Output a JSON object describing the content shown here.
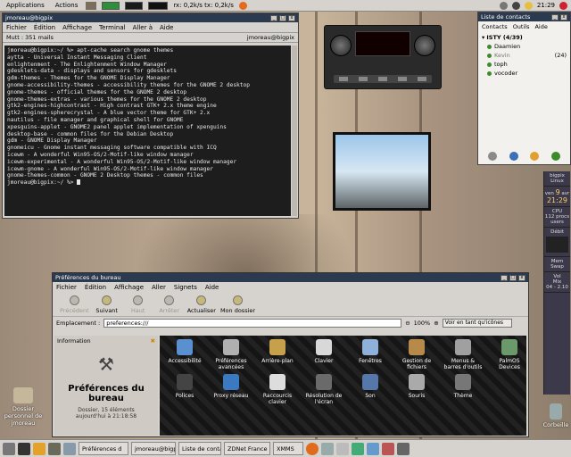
{
  "top_panel": {
    "applications": "Applications",
    "actions": "Actions",
    "net": "rx: 0,2k/s tx: 0,2k/s",
    "clock": "21:29"
  },
  "terminal": {
    "title": "jmoreau@bigpix",
    "menu": [
      "Fichier",
      "Édition",
      "Affichage",
      "Terminal",
      "Aller à",
      "Aide"
    ],
    "mutt_left": "Mutt : 351 mails",
    "mutt_right": "jmoreau@bigpix",
    "lines": [
      "jmoreau@bigpix:~/ %> apt-cache search gnome themes",
      "aytta - Universal Instant Messaging Client",
      "enlightenment - The Enlightenment Window Manager",
      "gdesklets-data - displays and sensors for gdesklets",
      "gdm-themes - Themes for the GNOME Display Manager",
      "gnome-accessibility-themes - accessibility themes for the GNOME 2 desktop",
      "gnome-themes - official themes for the GNOME 2 desktop",
      "gnome-themes-extras - various themes for the GNOME 2 desktop",
      "gtk2-engines-highcontrast - High contrast GTK+ 2.x theme engine",
      "gtk2-engines-spherecrystal - A blue vector theme for GTK+ 2.x",
      "nautilus - file manager and graphical shell for GNOME",
      "xpesguins-applet - GNOME2 panel applet implementation of xpenguins",
      "desktop-base - common files for the Debian Desktop",
      "gdm - GNOME Display Manager",
      "gnomeicu - Gnome instant messaging software compatible with ICQ",
      "icewm - A wonderful Win95-OS/2-Motif-like window manager",
      "icewm-experimental - A wonderful Win95-OS/2-Motif-like window manager",
      "icewm-gnome - A wonderful Win95-OS/2-Motif-like window manager",
      "gnome-themes-common - GNOME 2 Desktop themes - common files",
      "",
      "jmoreau@bigpix:~/ %>"
    ]
  },
  "contacts": {
    "title": "Liste de contacts",
    "menu": [
      "Contacts",
      "Outils",
      "Aide"
    ],
    "group": "ISTY (4/39)",
    "items": [
      {
        "name": "Daamien",
        "extra": ""
      },
      {
        "name": "Kevin",
        "extra": "(24)"
      },
      {
        "name": "toph",
        "extra": ""
      },
      {
        "name": "vocoder",
        "extra": ""
      }
    ]
  },
  "dock": {
    "host": "bigpix",
    "os": "Linux",
    "day": "ven",
    "date": "9",
    "month": "avr",
    "time": "21:29",
    "cpu": "CPU",
    "procs": "112 procs",
    "users": "users",
    "debit": "Débit",
    "mem": "Mem",
    "swap": "Swap",
    "vol": "Vol",
    "mix": "Mix",
    "ver": "04 - 2.10"
  },
  "file_manager": {
    "title": "Préférences du bureau",
    "menu": [
      "Fichier",
      "Édition",
      "Affichage",
      "Aller",
      "Signets",
      "Aide"
    ],
    "toolbar": [
      {
        "label": "Précédent",
        "disabled": true
      },
      {
        "label": "Suivant",
        "disabled": false
      },
      {
        "label": "Haut",
        "disabled": true
      },
      {
        "label": "Arrêter",
        "disabled": true
      },
      {
        "label": "Actualiser",
        "disabled": false
      },
      {
        "label": "Mon dossier",
        "disabled": false
      }
    ],
    "location_label": "Emplacement :",
    "location_value": "preferences:///",
    "zoom": "100%",
    "view_mode": "Voir en tant qu'icônes",
    "side_header": "Information",
    "side_title": "Préférences du bureau",
    "side_sub1": "Dossier, 15 éléments",
    "side_sub2": "aujourd'hui à 21:18:58",
    "icons": [
      "Accessibilité",
      "Préférences avancées",
      "Arrière-plan",
      "Clavier",
      "Fenêtres",
      "Gestion de fichiers",
      "Menus & barres d'outils",
      "PalmOS Devices",
      "Polices",
      "Proxy réseau",
      "Raccourcis clavier",
      "Résolution de l'écran",
      "Son",
      "Souris",
      "Thème"
    ]
  },
  "desktop": {
    "home_icon": "Dossier personnel de jmoreau",
    "trash_icon": "Corbeille"
  },
  "bottom_panel": {
    "tasks": [
      "Préférences d",
      "jmoreau@bigp",
      "Liste de conta",
      "ZDNet France",
      "XMMS"
    ]
  }
}
